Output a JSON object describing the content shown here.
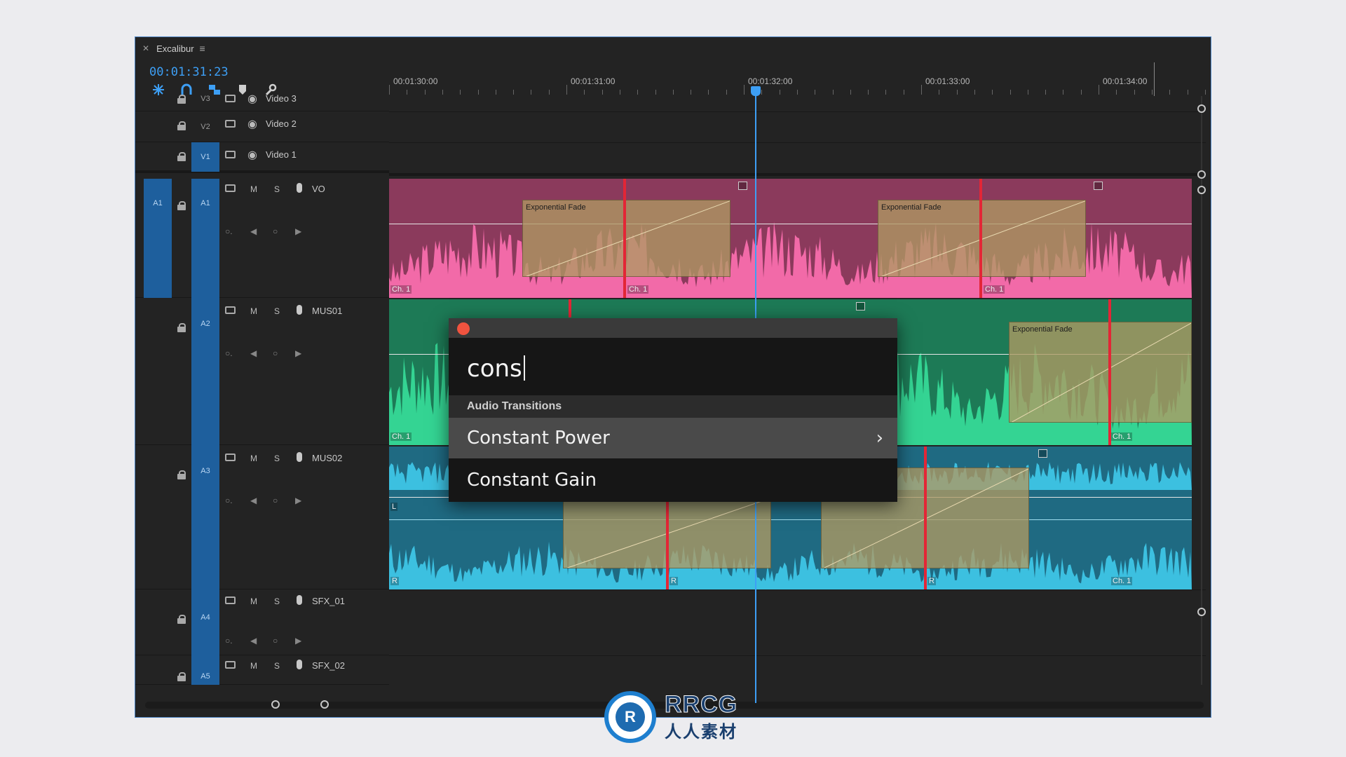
{
  "panel": {
    "title": "Excalibur",
    "timecode": "00:01:31:23"
  },
  "ruler": {
    "labels": [
      "00:01:30:00",
      "00:01:31:00",
      "00:01:32:00",
      "00:01:33:00",
      "00:01:34:00"
    ]
  },
  "tracks": {
    "v3": {
      "id": "V3",
      "name": "Video 3"
    },
    "v2": {
      "id": "V2",
      "name": "Video 2"
    },
    "v1": {
      "id": "V1",
      "name": "Video 1"
    },
    "a1": {
      "target": "A1",
      "id": "A1",
      "name": "VO"
    },
    "a2": {
      "id": "A2",
      "name": "MUS01"
    },
    "a3": {
      "id": "A3",
      "name": "MUS02"
    },
    "a4": {
      "id": "A4",
      "name": "SFX_01"
    },
    "a5": {
      "id": "A5",
      "name": "SFX_02"
    },
    "mute": "M",
    "solo": "S"
  },
  "clips": {
    "fade_label": "Exponential Fade",
    "channel_label": "Ch. 1",
    "left_label": "L",
    "right_label": "R"
  },
  "colors": {
    "vo_clip": "#f26aa8",
    "vo_bg": "#8b3a5c",
    "mus01_clip": "#34d493",
    "mus01_bg": "#1d7a56",
    "mus02_clip": "#3cc0e0",
    "mus02_bg": "#1f6a82",
    "playhead": "#3d9ff5",
    "cut": "#e32636"
  },
  "popup": {
    "search_value": "cons",
    "section": "Audio Transitions",
    "items": [
      "Constant Power",
      "Constant Gain"
    ]
  },
  "watermark": {
    "text": "RRCG",
    "subtitle": "人人素材"
  }
}
